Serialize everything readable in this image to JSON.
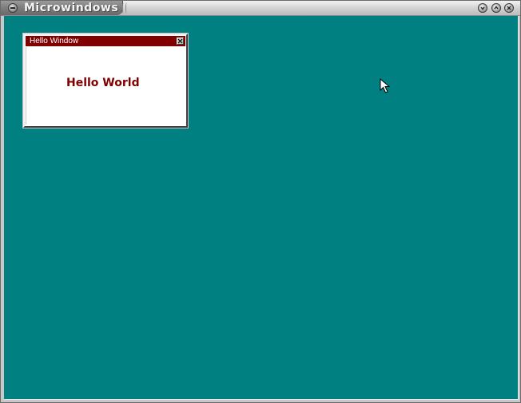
{
  "outer_window": {
    "title": "Microwindows",
    "controls": {
      "minimize_icon": "minimize-icon",
      "maximize_icon": "maximize-icon",
      "close_icon": "close-icon"
    }
  },
  "desktop": {
    "background_color": "#008080"
  },
  "hello_window": {
    "title": "Hello Window",
    "message": "Hello World",
    "title_color": "#800000",
    "message_color": "#800000",
    "close_icon": "close-icon"
  },
  "cursor": {
    "icon": "arrow-cursor-icon"
  }
}
